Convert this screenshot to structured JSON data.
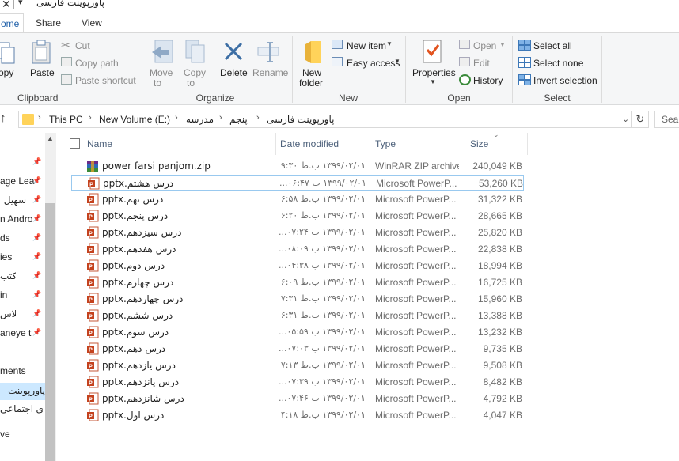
{
  "window": {
    "title": "پاورپوینت فارسی"
  },
  "tabs": [
    {
      "label": "ome"
    },
    {
      "label": "Share"
    },
    {
      "label": "View"
    }
  ],
  "ribbon": {
    "clipboard": {
      "label": "Clipboard",
      "copy": "opy",
      "paste": "Paste",
      "cut": "Cut",
      "copy_path": "Copy path",
      "paste_shortcut": "Paste shortcut"
    },
    "organize": {
      "label": "Organize",
      "move_to": "Move",
      "move_to_2": "to",
      "copy_to": "Copy",
      "copy_to_2": "to",
      "delete": "Delete",
      "rename": "Rename"
    },
    "new": {
      "label": "New",
      "new_folder": "New",
      "new_folder_2": "folder",
      "new_item": "New item",
      "easy_access": "Easy access"
    },
    "open": {
      "label": "Open",
      "properties": "Properties",
      "open": "Open",
      "edit": "Edit",
      "history": "History"
    },
    "select": {
      "label": "Select",
      "select_all": "Select all",
      "select_none": "Select none",
      "invert": "Invert selection"
    }
  },
  "address": {
    "crumbs": [
      "This PC",
      "New Volume (E:)",
      "مدرسه",
      "پنجم",
      "پاورپوینت فارسی"
    ],
    "search_placeholder": "Sear"
  },
  "nav": {
    "items": [
      {
        "label": "age Lea",
        "pinned": true
      },
      {
        "label": "سهیل",
        "pinned": true
      },
      {
        "label": "n Andro",
        "pinned": true
      },
      {
        "label": "ds",
        "pinned": true
      },
      {
        "label": "ies",
        "pinned": true
      },
      {
        "label": "کتب",
        "pinned": true
      },
      {
        "label": "in",
        "pinned": true
      },
      {
        "label": "کلاس",
        "pinned": true
      },
      {
        "label": "aneye tp",
        "pinned": true
      },
      {
        "label": "ments",
        "pinned": false
      },
      {
        "label": "پاورپوینت",
        "pinned": false
      },
      {
        "label": "ای اجتماعی",
        "pinned": false
      },
      {
        "label": "ve",
        "pinned": false
      }
    ]
  },
  "columns": {
    "name": "Name",
    "date": "Date modified",
    "type": "Type",
    "size": "Size"
  },
  "files": [
    {
      "name": "power farsi panjom.zip",
      "date": "۱۳۹۹/۰۲/۰۱ ب.ظ ۰۹:۳۰",
      "type": "WinRAR ZIP archive",
      "size": "240,049 KB",
      "icon": "zip-icon"
    },
    {
      "name": "درس هشتم.pptx",
      "date": "۱۳۹۹/۰۲/۰۱ ب ۰۶:۴۷...",
      "type": "Microsoft PowerP...",
      "size": "53,260 KB",
      "icon": "pptx-icon"
    },
    {
      "name": "درس نهم.pptx",
      "date": "۱۳۹۹/۰۲/۰۱ ب.ظ ۰۶:۵۸...",
      "type": "Microsoft PowerP...",
      "size": "31,322 KB",
      "icon": "pptx-icon"
    },
    {
      "name": "درس پنجم.pptx",
      "date": "۱۳۹۹/۰۲/۰۱ ب.ظ ۰۶:۲۰",
      "type": "Microsoft PowerP...",
      "size": "28,665 KB",
      "icon": "pptx-icon"
    },
    {
      "name": "درس سیزدهم.pptx",
      "date": "۱۳۹۹/۰۲/۰۱ ب ۰۷:۲۴...",
      "type": "Microsoft PowerP...",
      "size": "25,820 KB",
      "icon": "pptx-icon"
    },
    {
      "name": "درس هفدهم.pptx",
      "date": "۱۳۹۹/۰۲/۰۱ ب ۰۸:۰۹...",
      "type": "Microsoft PowerP...",
      "size": "22,838 KB",
      "icon": "pptx-icon"
    },
    {
      "name": "درس دوم.pptx",
      "date": "۱۳۹۹/۰۲/۰۱ ب ۰۴:۳۸...",
      "type": "Microsoft PowerP...",
      "size": "18,994 KB",
      "icon": "pptx-icon"
    },
    {
      "name": "درس چهارم.pptx",
      "date": "۱۳۹۹/۰۲/۰۱ ب.ظ ۰۶:۰۹",
      "type": "Microsoft PowerP...",
      "size": "16,725 KB",
      "icon": "pptx-icon"
    },
    {
      "name": "درس چهاردهم.pptx",
      "date": "۱۳۹۹/۰۲/۰۱ ب.ظ ۰۷:۳۱",
      "type": "Microsoft PowerP...",
      "size": "15,960 KB",
      "icon": "pptx-icon"
    },
    {
      "name": "درس ششم.pptx",
      "date": "۱۳۹۹/۰۲/۰۱ ب.ظ ۰۶:۳۱",
      "type": "Microsoft PowerP...",
      "size": "13,388 KB",
      "icon": "pptx-icon"
    },
    {
      "name": "درس سوم.pptx",
      "date": "۱۳۹۹/۰۲/۰۱ ب ۰۵:۵۹...",
      "type": "Microsoft PowerP...",
      "size": "13,232 KB",
      "icon": "pptx-icon"
    },
    {
      "name": "درس دهم.pptx",
      "date": "۱۳۹۹/۰۲/۰۱ ب ۰۷:۰۳...",
      "type": "Microsoft PowerP...",
      "size": "9,735 KB",
      "icon": "pptx-icon"
    },
    {
      "name": "درس یازدهم.pptx",
      "date": "۱۳۹۹/۰۲/۰۱ ب.ظ ۰۷:۱۳",
      "type": "Microsoft PowerP...",
      "size": "9,508 KB",
      "icon": "pptx-icon"
    },
    {
      "name": "درس پانزدهم.pptx",
      "date": "۱۳۹۹/۰۲/۰۱ ب ۰۷:۳۹...",
      "type": "Microsoft PowerP...",
      "size": "8,482 KB",
      "icon": "pptx-icon"
    },
    {
      "name": "درس شانزدهم.pptx",
      "date": "۱۳۹۹/۰۲/۰۱ ب ۰۷:۴۶...",
      "type": "Microsoft PowerP...",
      "size": "4,792 KB",
      "icon": "pptx-icon"
    },
    {
      "name": "درس اول.pptx",
      "date": "۱۳۹۹/۰۲/۰۱ ب.ظ ۰۴:۱۸",
      "type": "Microsoft PowerP...",
      "size": "4,047 KB",
      "icon": "pptx-icon"
    }
  ]
}
